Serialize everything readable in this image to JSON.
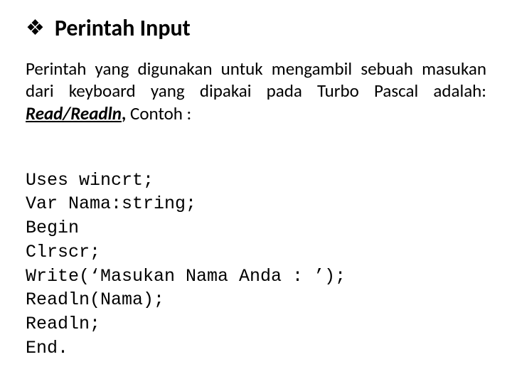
{
  "heading": {
    "bullet": "❖",
    "title": "Perintah Input"
  },
  "paragraph": {
    "lead": "Perintah yang digunakan untuk mengambil sebuah masukan dari keyboard yang dipakai pada Turbo Pascal adalah: ",
    "keyword": "Read/Readln",
    "tail_comma": ", ",
    "tail": "Contoh :"
  },
  "code": {
    "l1": "Uses wincrt;",
    "l2": "Var Nama:string;",
    "l3": "Begin",
    "l4": "Clrscr;",
    "l5": "Write(‘Masukan Nama Anda : ’);",
    "l6": "Readln(Nama);",
    "l7": "Readln;",
    "l8": "End."
  }
}
